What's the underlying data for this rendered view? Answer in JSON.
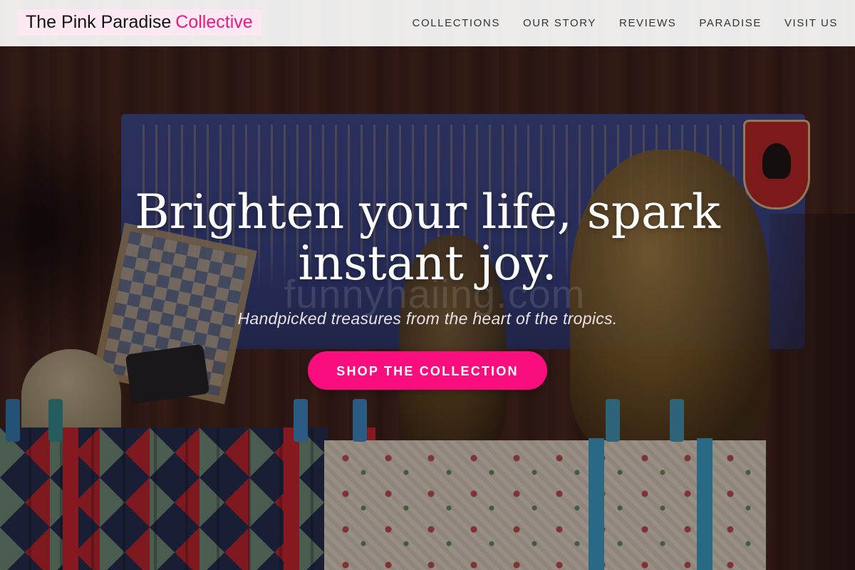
{
  "site": {
    "brand_main": "The Pink Paradise",
    "brand_accent": "Collective"
  },
  "nav": {
    "items": [
      {
        "label": "COLLECTIONS"
      },
      {
        "label": "OUR STORY"
      },
      {
        "label": "REVIEWS"
      },
      {
        "label": "PARADISE"
      },
      {
        "label": "VISIT US"
      }
    ]
  },
  "hero": {
    "headline_line1": "Brighten your life, spark",
    "headline_line2": "instant joy.",
    "tagline": "Handpicked treasures from the heart of the tropics.",
    "cta_label": "SHOP THE COLLECTION",
    "watermark": "funnyhaiing.com"
  },
  "colors": {
    "accent": "#fa0d7d",
    "brand_accent_text": "#ea1a7f",
    "brand_badge_bg": "#fce8f2",
    "navbar_bg": "#f4f4f4"
  }
}
